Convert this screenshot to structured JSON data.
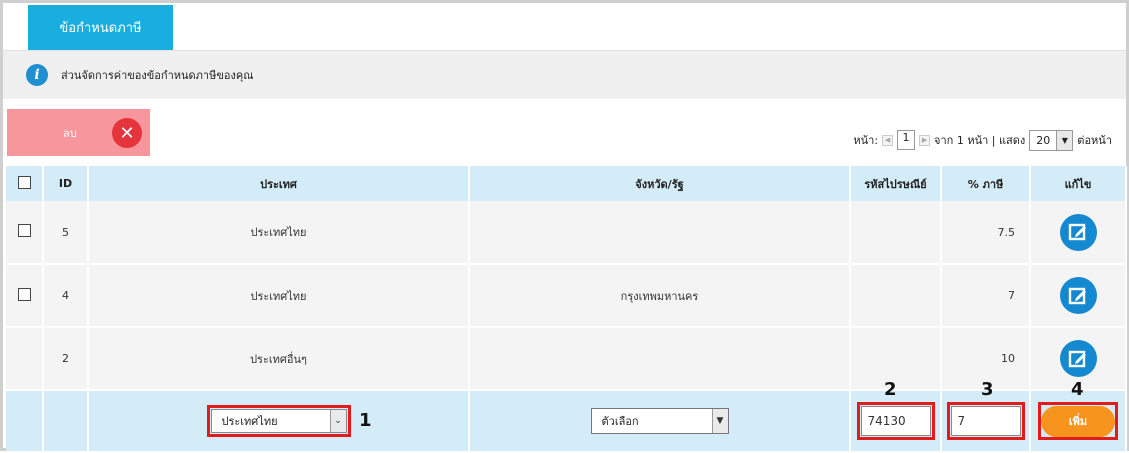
{
  "header": {
    "tab_title": "ข้อกำหนดภาษี"
  },
  "info": {
    "text": "ส่วนจัดการค่าของข้อกำหนดภาษีของคุณ"
  },
  "toolbar": {
    "delete_label": "ลบ"
  },
  "pager": {
    "page_label": "หน้า:",
    "page_value": "1",
    "of_text": "จาก 1 หน้า | แสดง",
    "per_page": "20",
    "per_page_suffix": "ต่อหน้า"
  },
  "table": {
    "headers": {
      "id": "ID",
      "country": "ประเทศ",
      "province": "จังหวัด/รัฐ",
      "postcode": "รหัสไปรษณีย์",
      "tax": "% ภาษี",
      "edit": "แก้ไข"
    },
    "rows": [
      {
        "id": "5",
        "country": "ประเทศไทย",
        "province": "",
        "postcode": "",
        "tax": "7.5"
      },
      {
        "id": "4",
        "country": "ประเทศไทย",
        "province": "กรุงเทพมหานคร",
        "postcode": "",
        "tax": "7"
      },
      {
        "id": "2",
        "country": "ประเทศอื่นๆ",
        "province": "",
        "postcode": "",
        "tax": "10"
      }
    ]
  },
  "add_form": {
    "country_value": "ประเทศไทย",
    "province_value": "ตัวเลือก",
    "postcode_value": "74130",
    "tax_value": "7",
    "add_label": "เพิ่ม"
  },
  "markers": {
    "m1": "1",
    "m2": "2",
    "m3": "3",
    "m4": "4"
  },
  "colors": {
    "accent": "#1aaee0",
    "header_bg": "#d4ecf7",
    "delete_bg": "#f7969c",
    "add_btn": "#f7941d",
    "highlight": "#e21b1b"
  }
}
